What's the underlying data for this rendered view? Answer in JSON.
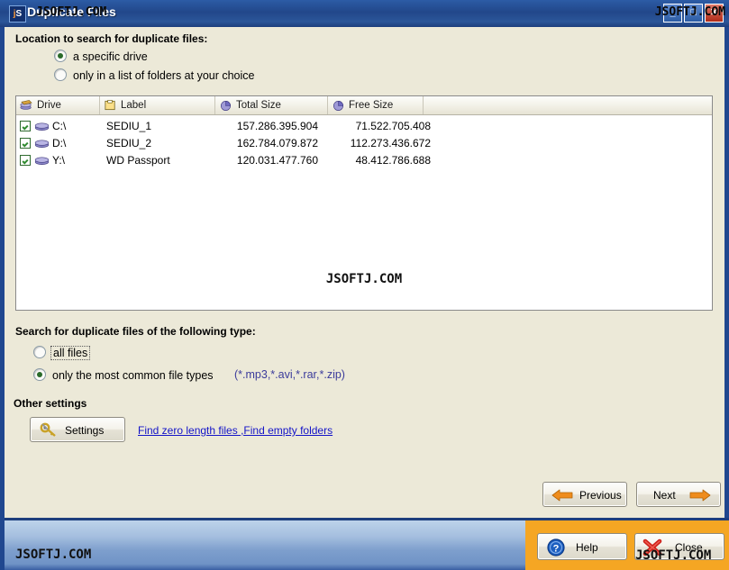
{
  "window": {
    "title": "Duplicate Files",
    "icon_label": "jS",
    "watermark": "JSOFTJ.COM",
    "controls": [
      {
        "name": "minimize",
        "glyph": "_"
      },
      {
        "name": "maximize",
        "glyph": "□"
      },
      {
        "name": "close",
        "glyph": "✕"
      }
    ]
  },
  "location_section": {
    "title": "Location to search for duplicate files:",
    "options": [
      {
        "label": "a specific drive",
        "selected": true
      },
      {
        "label": "only in a list of folders at your choice",
        "selected": false
      }
    ]
  },
  "drive_list": {
    "columns": [
      {
        "label": "Drive",
        "icon": "drive-stack-icon"
      },
      {
        "label": "Label",
        "icon": "tag-icon"
      },
      {
        "label": "Total Size",
        "icon": "pie-chart-icon"
      },
      {
        "label": "Free Size",
        "icon": "pie-chart-icon"
      }
    ],
    "rows": [
      {
        "checked": true,
        "drive": "C:\\",
        "label": "SEDIU_1",
        "total_size": "157.286.395.904",
        "free_size": "71.522.705.408"
      },
      {
        "checked": true,
        "drive": "D:\\",
        "label": "SEDIU_2",
        "total_size": "162.784.079.872",
        "free_size": "112.273.436.672"
      },
      {
        "checked": true,
        "drive": "Y:\\",
        "label": "WD Passport",
        "total_size": "120.031.477.760",
        "free_size": "48.412.786.688"
      }
    ],
    "watermark": "JSOFTJ.COM"
  },
  "type_section": {
    "title": "Search for duplicate files of the following type:",
    "options": [
      {
        "label": "all files",
        "selected": false,
        "focused": true
      },
      {
        "label": "only the most common file types",
        "selected": true,
        "focused": false
      }
    ],
    "extensions": "(*.mp3,*.avi,*.rar,*.zip)"
  },
  "other_section": {
    "title": "Other settings",
    "settings_button": "Settings",
    "link_zero_length": "Find zero length files ",
    "link_empty_folders": ",Find empty folders "
  },
  "nav": {
    "previous": "Previous",
    "next": "Next"
  },
  "footer": {
    "help": "Help",
    "close": "Close",
    "watermark_left": "JSOFTJ.COM",
    "watermark_right": "JSOFTJ.COM"
  },
  "colors": {
    "title_blue": "#22478a",
    "border_blue": "#20478f",
    "panel": "#ece9d8",
    "accent_orange": "#f5a623",
    "link_blue": "#1414c8",
    "ext_text": "#3b3b9b"
  }
}
